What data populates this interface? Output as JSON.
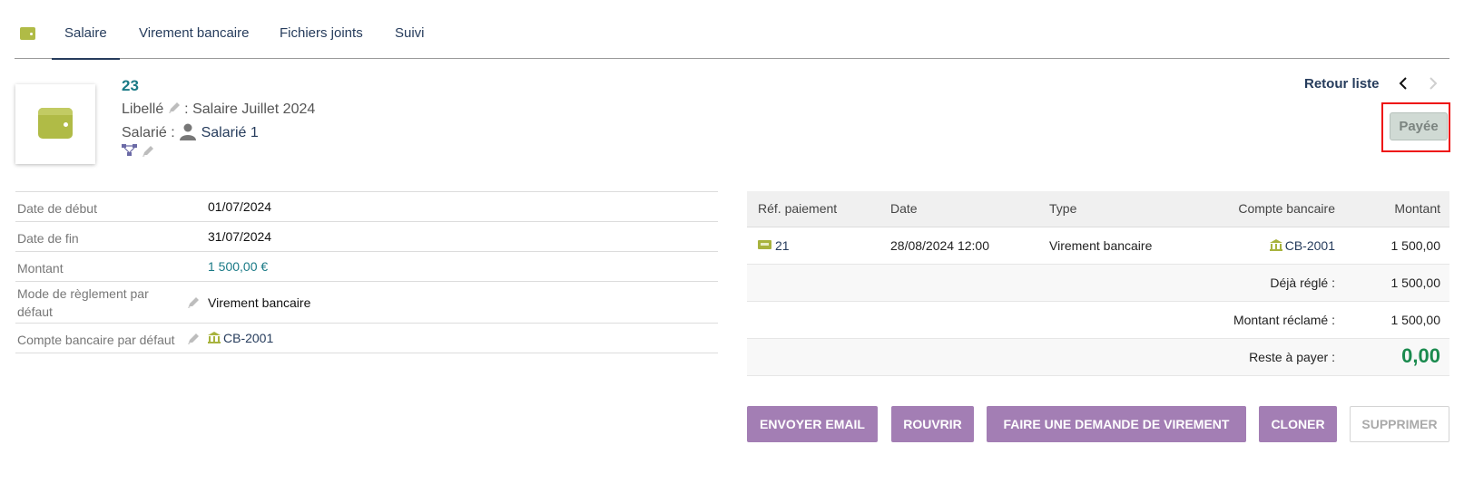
{
  "tabs": [
    {
      "label": "Salaire"
    },
    {
      "label": "Virement bancaire"
    },
    {
      "label": "Fichiers joints"
    },
    {
      "label": "Suivi"
    }
  ],
  "header": {
    "ref": "23",
    "libelle_label": "Libellé",
    "libelle_value": ": Salaire Juillet 2024",
    "salarie_label": "Salarié :",
    "salarie_value": "Salarié 1",
    "back_link": "Retour liste",
    "status": "Payée"
  },
  "details": [
    {
      "label": "Date de début",
      "value": "01/07/2024"
    },
    {
      "label": "Date de fin",
      "value": "31/07/2024"
    },
    {
      "label": "Montant",
      "value": "1 500,00 €"
    },
    {
      "label": "Mode de règlement par défaut",
      "value": "Virement bancaire"
    },
    {
      "label": "Compte bancaire par défaut",
      "value": "CB-2001"
    }
  ],
  "payments": {
    "headers": [
      "Réf. paiement",
      "Date",
      "Type",
      "Compte bancaire",
      "Montant"
    ],
    "rows": [
      {
        "ref": "21",
        "date": "28/08/2024 12:00",
        "type": "Virement bancaire",
        "account": "CB-2001",
        "amount": "1 500,00"
      }
    ],
    "summary": [
      {
        "label": "Déjà réglé :",
        "value": "1 500,00"
      },
      {
        "label": "Montant réclamé :",
        "value": "1 500,00"
      },
      {
        "label": "Reste à payer :",
        "value": "0,00"
      }
    ]
  },
  "actions": {
    "send_email": "ENVOYER EMAIL",
    "reopen": "ROUVRIR",
    "transfer_request": "FAIRE UNE DEMANDE DE VIREMENT",
    "clone": "CLONER",
    "delete": "SUPPRIMER"
  },
  "colors": {
    "accent_purple": "#a37eb4",
    "brand_green": "#b0bb46",
    "link_navy": "#263c5c",
    "status_outline": "#e11111",
    "remain_green": "#1a8a4e"
  },
  "icons": {
    "tab": "wallet-icon",
    "logo": "wallet-icon",
    "edit": "pencil-icon",
    "user": "person-icon",
    "hierarchy": "hierarchy-icon",
    "bank": "bank-icon",
    "payment": "payment-icon",
    "prev": "chevron-left-icon",
    "next": "chevron-right-icon"
  }
}
